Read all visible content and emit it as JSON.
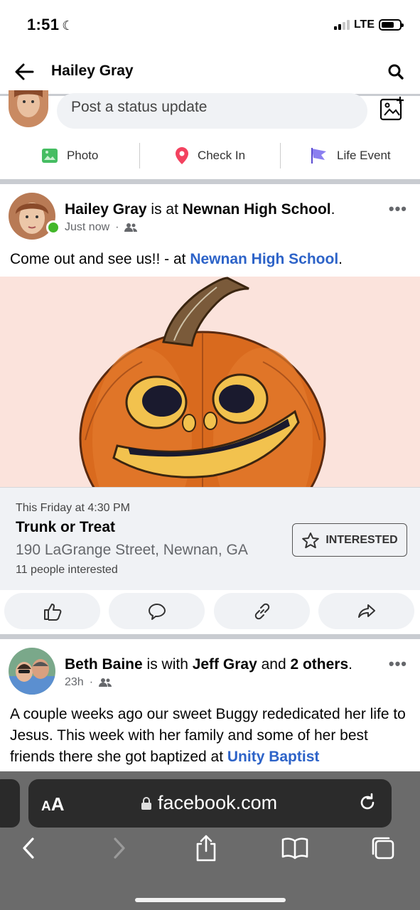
{
  "status_bar": {
    "time": "1:51",
    "network": "LTE"
  },
  "nav": {
    "title": "Hailey Gray"
  },
  "composer": {
    "placeholder": "Post a status update",
    "actions": [
      {
        "label": "Photo",
        "icon": "photo-icon",
        "color": "#45bd62"
      },
      {
        "label": "Check In",
        "icon": "location-pin-icon",
        "color": "#f3425f"
      },
      {
        "label": "Life Event",
        "icon": "flag-icon",
        "color": "#7b64ff"
      }
    ]
  },
  "post1": {
    "author": "Hailey Gray",
    "connector": " is at ",
    "place": "Newnan High School",
    "end": ".",
    "time": "Just now",
    "dot": "·",
    "text_prefix": "Come out and see us!! - at ",
    "text_link": "Newnan High School",
    "text_suffix": ".",
    "more": "•••",
    "event": {
      "date": "This Friday at 4:30 PM",
      "title": "Trunk or Treat",
      "location": "190 LaGrange Street, Newnan, GA",
      "count": "11 people interested",
      "button": "INTERESTED"
    },
    "reactions": [
      "like-icon",
      "comment-icon",
      "link-icon",
      "share-icon"
    ]
  },
  "post2": {
    "author": "Beth Baine",
    "connector": " is with ",
    "tagged": "Jeff Gray",
    "and": " and ",
    "others": "2 others",
    "end": ".",
    "time": "23h",
    "dot": "·",
    "more": "•••",
    "text": "A couple weeks ago our sweet Buggy rededicated her life to Jesus. This week with her family and some of her best friends there she got baptized at ",
    "text_link": "Unity Baptist"
  },
  "browser": {
    "aa_small": "A",
    "aa_large": "A",
    "url": "facebook.com"
  },
  "colors": {
    "accent": "#2d63c8",
    "online": "#42b72a",
    "browser_bg": "#6b6b6b"
  }
}
